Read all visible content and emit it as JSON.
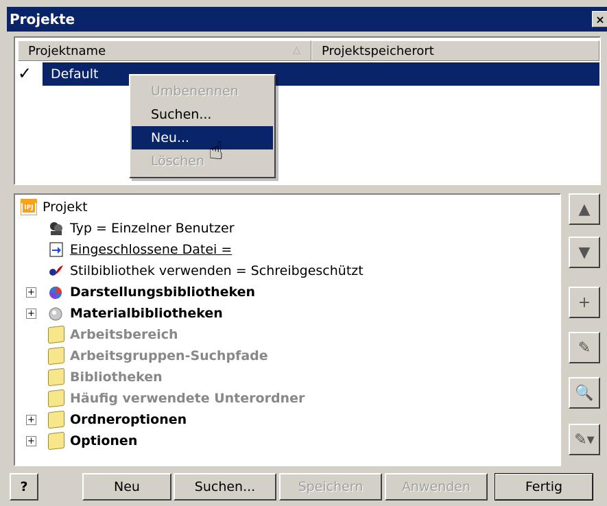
{
  "window": {
    "title": "Projekte",
    "close_label": "×"
  },
  "listview": {
    "columns": [
      "Projektname",
      "Projektspeicherort"
    ],
    "sort_indicator": "△",
    "rows": [
      {
        "check": "✓",
        "name": "Default"
      }
    ]
  },
  "context_menu": {
    "items": [
      {
        "label": "Umbenennen",
        "enabled": false
      },
      {
        "label": "Suchen...",
        "enabled": true
      },
      {
        "label": "Neu...",
        "enabled": true,
        "highlighted": true
      },
      {
        "label": "Löschen",
        "enabled": false
      }
    ]
  },
  "tree": {
    "items": [
      {
        "label": "Projekt",
        "icon": "ipj-file-icon",
        "style": "normal"
      },
      {
        "label": "Typ = Einzelner Benutzer",
        "icon": "user-type-icon",
        "style": "normal"
      },
      {
        "label": "Eingeschlossene Datei = ",
        "icon": "included-file-icon",
        "style": "underline"
      },
      {
        "label": "Stilbibliothek verwenden = Schreibgeschützt",
        "icon": "style-library-icon",
        "style": "normal"
      },
      {
        "label": "Darstellungsbibliotheken",
        "icon": "appearance-library-icon",
        "style": "bold",
        "expand": "+"
      },
      {
        "label": "Materialbibliotheken",
        "icon": "material-library-icon",
        "style": "bold",
        "expand": "+"
      },
      {
        "label": "Arbeitsbereich",
        "icon": "folder-icon",
        "style": "gray"
      },
      {
        "label": "Arbeitsgruppen-Suchpfade",
        "icon": "folder-icon",
        "style": "gray"
      },
      {
        "label": "Bibliotheken",
        "icon": "folder-icon",
        "style": "gray"
      },
      {
        "label": "Häufig verwendete Unterordner",
        "icon": "folder-icon",
        "style": "gray"
      },
      {
        "label": "Ordneroptionen",
        "icon": "folder-icon",
        "style": "bold",
        "expand": "+"
      },
      {
        "label": "Optionen",
        "icon": "folder-icon",
        "style": "bold",
        "expand": "+"
      }
    ]
  },
  "side_buttons": [
    {
      "icon": "move-up-icon",
      "glyph": "▲"
    },
    {
      "icon": "move-down-icon",
      "glyph": "▼"
    },
    {
      "icon": "add-icon",
      "glyph": "+"
    },
    {
      "icon": "edit-pencil-icon",
      "glyph": "✎"
    },
    {
      "icon": "search-magnifier-icon",
      "glyph": "🔍"
    },
    {
      "icon": "edit-dropdown-icon",
      "glyph": "✎▾"
    }
  ],
  "buttons": {
    "help": "?",
    "neu": "Neu",
    "suchen": "Suchen...",
    "speichern": "Speichern",
    "anwenden": "Anwenden",
    "fertig": "Fertig"
  },
  "colors": {
    "selection": "#0a246a",
    "face": "#d4d0c8",
    "disabled": "#a0a0a0",
    "ipj_orange": "#f7a21b"
  }
}
